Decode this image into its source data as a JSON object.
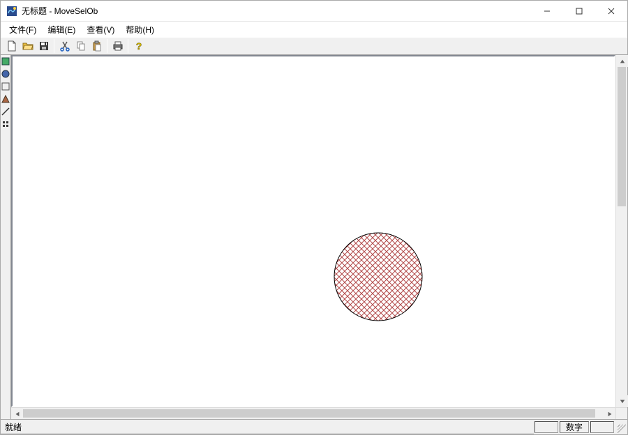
{
  "titlebar": {
    "title": "无标题 - MoveSelOb"
  },
  "menu": {
    "file": "文件(F)",
    "edit": "编辑(E)",
    "view": "查看(V)",
    "help": "帮助(H)"
  },
  "toolbar_icons": {
    "new": "new-file-icon",
    "open": "open-folder-icon",
    "save": "save-icon",
    "cut": "cut-icon",
    "copy": "copy-icon",
    "paste": "paste-icon",
    "print": "print-icon",
    "help": "help-icon"
  },
  "status": {
    "ready": "就绪",
    "numlock": "数字"
  },
  "shape": {
    "type": "circle",
    "fill_pattern": "diagonal-crosshatch",
    "pattern_color": "#b24a4a",
    "stroke": "#000000"
  }
}
